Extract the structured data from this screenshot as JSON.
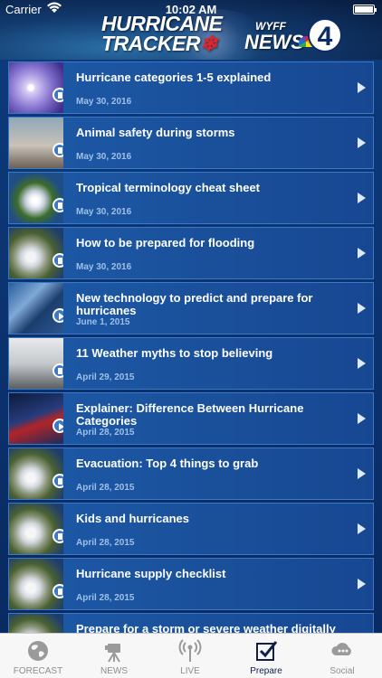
{
  "status_bar": {
    "carrier": "Carrier",
    "time": "10:02 AM"
  },
  "header": {
    "title_line1": "HURRICANE",
    "title_line2": "TRACKER",
    "station_call": "WYFF",
    "station_news": "NEWS",
    "channel_number": "4"
  },
  "articles": [
    {
      "title": "Hurricane categories 1-5 explained",
      "date": "May 30, 2016",
      "badge": "doc-icon"
    },
    {
      "title": "Animal safety during storms",
      "date": "May 30, 2016",
      "badge": "doc-icon"
    },
    {
      "title": "Tropical terminology cheat sheet",
      "date": "May 30, 2016",
      "badge": "doc-icon"
    },
    {
      "title": "How to be prepared for flooding",
      "date": "May 30, 2016",
      "badge": "doc-icon"
    },
    {
      "title": "New technology to predict and prepare for hurricanes",
      "date": "June 1, 2015",
      "badge": "play-icon"
    },
    {
      "title": "11 Weather myths to stop believing",
      "date": "April 29, 2015",
      "badge": "doc-icon"
    },
    {
      "title": "Explainer: Difference Between Hurricane Categories",
      "date": "April 28, 2015",
      "badge": "play-icon"
    },
    {
      "title": "Evacuation: Top 4 things to grab",
      "date": "April 28, 2015",
      "badge": "doc-icon"
    },
    {
      "title": "Kids and hurricanes",
      "date": "April 28, 2015",
      "badge": "doc-icon"
    },
    {
      "title": "Hurricane supply checklist",
      "date": "April 28, 2015",
      "badge": "doc-icon"
    },
    {
      "title": "Prepare for a storm or severe weather digitally",
      "date": "",
      "badge": "doc-icon"
    }
  ],
  "tabs": [
    {
      "label": "FORECAST",
      "icon": "globe-icon",
      "active": false
    },
    {
      "label": "NEWS",
      "icon": "camera-icon",
      "active": false
    },
    {
      "label": "LIVE",
      "icon": "broadcast-icon",
      "active": false
    },
    {
      "label": "Prepare",
      "icon": "checkbox-icon",
      "active": true
    },
    {
      "label": "Social",
      "icon": "cloud-icon",
      "active": false
    }
  ],
  "colors": {
    "accent": "#1d5aa8",
    "active_tab": "#0f1f4a",
    "brand_red": "#e2232a"
  }
}
